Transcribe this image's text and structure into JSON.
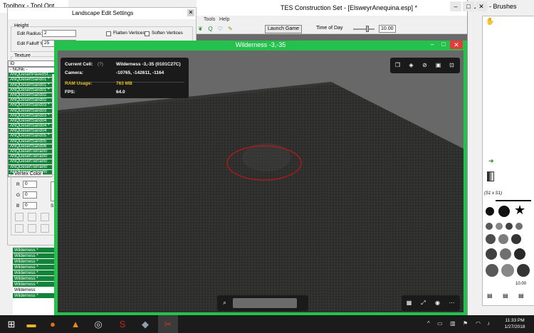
{
  "tes": {
    "title": "TES Construction Set - [ElsweyrAnequina.esp] *",
    "menu": [
      "Tools",
      "Help"
    ],
    "launch_game": "Launch Game",
    "time_of_day_label": "Time of Day",
    "time_value": "10.00"
  },
  "toolbox": {
    "title": "Toolbox - Tool Opt..."
  },
  "landscape": {
    "title": "Landscape Edit Settings",
    "height_legend": "Height",
    "edit_radius_label": "Edit Radius:",
    "edit_radius_value": "2",
    "edit_falloff_label": "Edit Falloff %:",
    "edit_falloff_value": "25",
    "flatten_label": "Flatten Vertices",
    "soften_label": "Soften Vertices",
    "texture_legend": "Texture",
    "texture_header": "ID",
    "texture_items": [
      "- NONE -",
      "ANQDesertPavedSt...",
      "ANQDesertSand01 *",
      "ANQDesertSand01 *",
      "ANQDesertSand01 *",
      "ANQDesertSand02",
      "ANQDesertSand02",
      "ANQDesertSand03 *",
      "ANQDesertSand03",
      "ANQDesertSand03 *",
      "ANQDesertSand04",
      "ANQDesertSand04 *",
      "ANQDesertSand04",
      "ANQDesertSand05 *",
      "ANQDesertSand05",
      "ANQDesertSand06",
      "ANQDesertTerrain0",
      "ANQDesertTerrain0",
      "ANQDesertTerrain0",
      "ANQDesertTerrain0",
      "ANQDesertTerrain0"
    ],
    "vertex_legend": "Vertex Color",
    "r_label": "R",
    "g_label": "G",
    "b_label": "B",
    "r_value": "0",
    "g_value": "0",
    "b_value": "0",
    "s_label": "S"
  },
  "cells": [
    "Wilderness *",
    "Wilderness *",
    "Wilderness *",
    "Wilderness *",
    "Wilderness *",
    "Wilderness *",
    "Wilderness *",
    "Wilderness",
    "Wilderness *"
  ],
  "right": {
    "title": "Undo - Brushes",
    "brush_label": "(S1 x S1)",
    "brush_value": "10.00"
  },
  "viewport": {
    "title": "Wilderness -3,-35",
    "current_cell_label": "Current Cell:",
    "help_hint": "(?)",
    "current_cell_value": "Wilderness -3,-35 (0101C27C)",
    "camera_label": "Camera:",
    "camera_value": "-10765, -142611, -1164",
    "ram_label": "RAM Usage:",
    "ram_value": "763 MB",
    "fps_label": "FPS:",
    "fps_value": "64.0"
  },
  "taskbar": {
    "time": "11:33 PM",
    "date": "1/27/2018"
  }
}
